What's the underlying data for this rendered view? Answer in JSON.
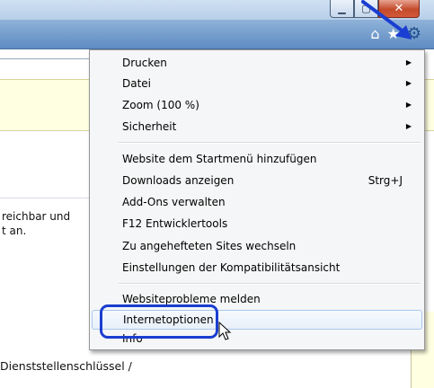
{
  "window": {
    "minimize_glyph": "▁",
    "maximize_glyph": "▢",
    "close_glyph": "✕"
  },
  "toolbar": {
    "home_glyph": "⌂",
    "favorites_glyph": "★",
    "tools_glyph": "⚙"
  },
  "content": {
    "fragment_line1": "reichbar und",
    "fragment_line2": "t an.",
    "bottom_text": "Dienststellenschlüssel /"
  },
  "menu": {
    "items": [
      {
        "label": "Drucken",
        "has_submenu": true
      },
      {
        "label": "Datei",
        "has_submenu": true
      },
      {
        "label": "Zoom (100 %)",
        "has_submenu": true
      },
      {
        "label": "Sicherheit",
        "has_submenu": true
      },
      {
        "label": "Website dem Startmenü hinzufügen"
      },
      {
        "label": "Downloads anzeigen",
        "shortcut": "Strg+J"
      },
      {
        "label": "Add-Ons verwalten"
      },
      {
        "label": "F12 Entwicklertools"
      },
      {
        "label": "Zu angehefteten Sites wechseln"
      },
      {
        "label": "Einstellungen der Kompatibilitätsansicht"
      },
      {
        "label": "Websiteprobleme melden"
      },
      {
        "label": "Internetoptionen",
        "hovered": true
      },
      {
        "label": "Info"
      }
    ],
    "submenu_arrow": "▶"
  },
  "colors": {
    "toolbar": "#6f98cc",
    "tools_icon": "#1f4f8c",
    "annotation": "#1a3ed1",
    "menu_background": "#f5f6f7",
    "hover_border": "#a8c8ec",
    "info_background": "#ffffe1"
  },
  "icons": {
    "home": "home-icon",
    "favorites": "star-icon",
    "tools": "gear-icon",
    "pointer": "mouse-cursor-icon"
  }
}
